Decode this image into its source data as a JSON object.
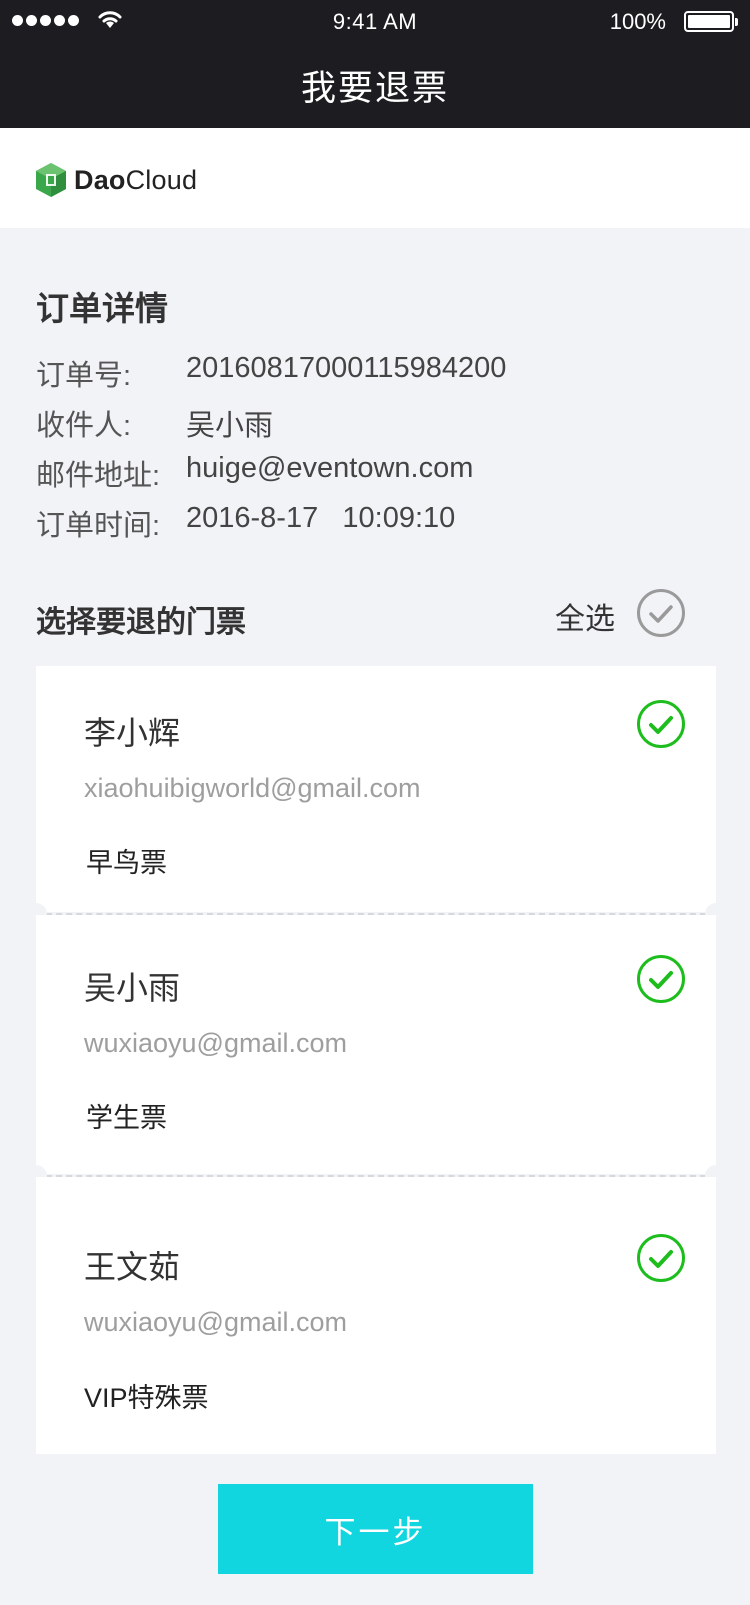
{
  "status_bar": {
    "time": "9:41 AM",
    "battery": "100%"
  },
  "header": {
    "title": "我要退票"
  },
  "logo": {
    "bold": "Dao",
    "rest": "Cloud"
  },
  "order": {
    "title": "订单详情",
    "rows": [
      {
        "label": "订单号:",
        "value": "20160817000115984200"
      },
      {
        "label": "收件人:",
        "value": "吴小雨"
      },
      {
        "label": "邮件地址:",
        "value": "huige@eventown.com"
      },
      {
        "label": "订单时间:",
        "value": "2016-8-17   10:09:10"
      }
    ]
  },
  "selection": {
    "title": "选择要退的门票",
    "select_all": "全选"
  },
  "tickets": [
    {
      "name": "李小辉",
      "email": "xiaohuibigworld@gmail.com",
      "type": "早鸟票",
      "checked": true
    },
    {
      "name": "吴小雨",
      "email": "wuxiaoyu@gmail.com",
      "type": "学生票",
      "checked": true
    },
    {
      "name": "王文茹",
      "email": "wuxiaoyu@gmail.com",
      "type": "VIP特殊票",
      "checked": true
    }
  ],
  "actions": {
    "next": "下一步"
  },
  "colors": {
    "accent": "#11d6df",
    "check_green": "#1ebd1e",
    "header_bg": "#1d1d21"
  }
}
